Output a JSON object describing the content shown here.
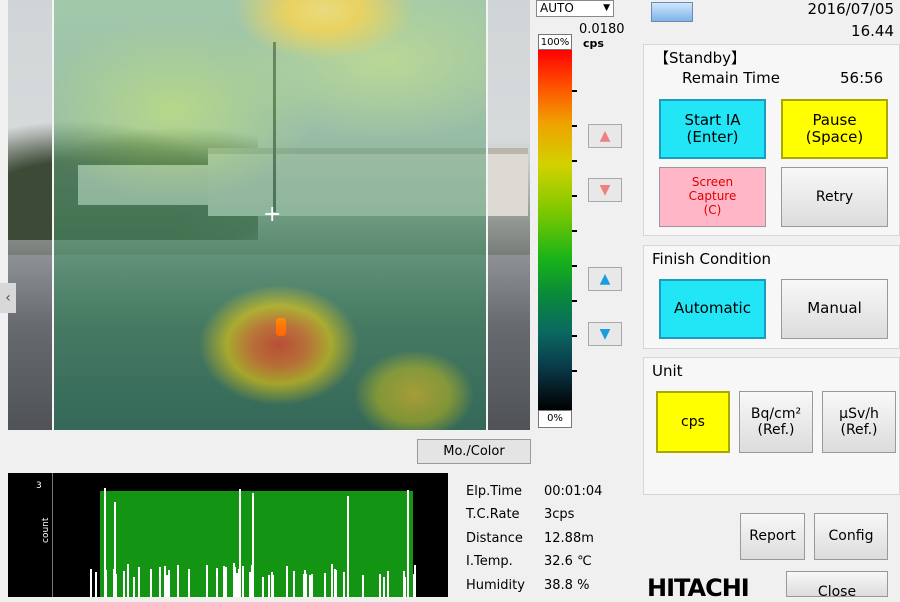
{
  "header": {
    "date": "2016/07/05",
    "time": "16.44"
  },
  "scale": {
    "mode_select": "AUTO",
    "max_value": "0.0180",
    "unit": "cps",
    "top_label": "100%",
    "bottom_label": "0%"
  },
  "camera": {
    "buttons": {
      "mono_color": "Mo./Color"
    },
    "arrows": {
      "color_up": "▲",
      "color_down": "▼",
      "scale_up": "▲",
      "scale_down": "▼",
      "left": "‹"
    }
  },
  "graph": {
    "y_max": "3",
    "y_label": "count"
  },
  "stats": [
    {
      "label": "Elp.Time",
      "value": "00:01:04"
    },
    {
      "label": "T.C.Rate",
      "value": "3cps"
    },
    {
      "label": "Distance",
      "value": "12.88m"
    },
    {
      "label": "I.Temp.",
      "value": "32.6 ℃"
    },
    {
      "label": "Humidity",
      "value": "38.8 %"
    }
  ],
  "standby": {
    "title": "【Standby】",
    "remain_label": "Remain Time",
    "remain_value": "56:56",
    "start_ia": "Start IA",
    "start_ia_key": "(Enter)",
    "pause": "Pause",
    "pause_key": "(Space)",
    "screen_capture": "Screen",
    "screen_capture_2": "Capture",
    "screen_capture_key": "(C)",
    "retry": "Retry"
  },
  "finish": {
    "title": "Finish Condition",
    "automatic": "Automatic",
    "manual": "Manual"
  },
  "unit": {
    "title": "Unit",
    "cps": "cps",
    "bq": "Bq/cm²",
    "bq_ref": "(Ref.)",
    "usv": "μSv/h",
    "usv_ref": "(Ref.)"
  },
  "footer": {
    "report": "Report",
    "config": "Config",
    "close": "Close",
    "brand": "HITACHI"
  },
  "colors": {
    "accent_cyan": "#22e6f6",
    "accent_yellow": "#ffff00",
    "capture_pink": "#ffb6c6",
    "graph_green": "#139413"
  }
}
